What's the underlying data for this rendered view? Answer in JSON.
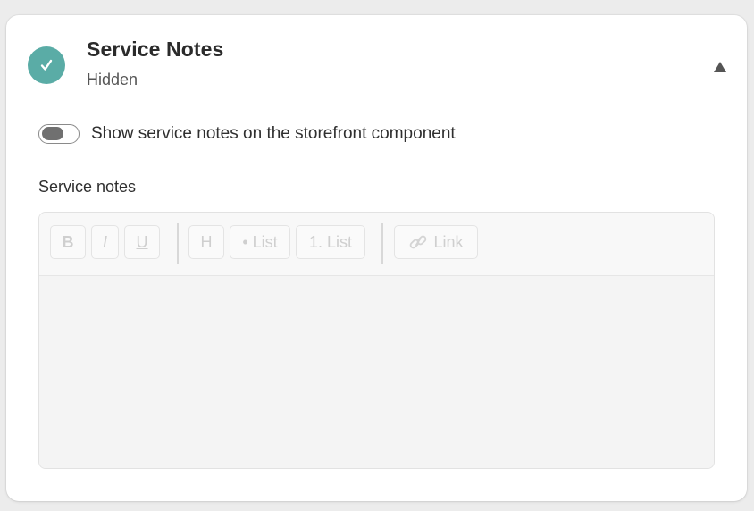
{
  "section": {
    "title": "Service Notes",
    "status": "Hidden",
    "icons": {
      "status": "check-icon",
      "collapse": "triangle-up-icon"
    },
    "colors": {
      "status_circle": "#5aaca6"
    }
  },
  "toggle": {
    "label": "Show service notes on the storefront component",
    "checked": false
  },
  "editor": {
    "label": "Service notes",
    "toolbar": {
      "bold": "B",
      "italic": "I",
      "underline": "U",
      "heading": "H",
      "bullet_list": "• List",
      "numbered_list": "1. List",
      "link": "Link"
    },
    "content": ""
  }
}
